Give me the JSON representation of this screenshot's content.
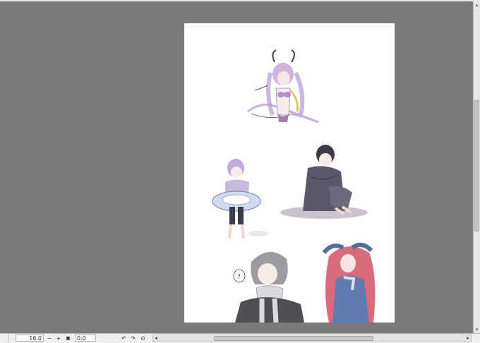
{
  "toolbar": {
    "zoom_value": "16.0",
    "zoom_out_glyph": "−",
    "zoom_in_glyph": "+",
    "fit_glyph": "■",
    "rotate_value": "0.0",
    "rotate_left_glyph": "↶",
    "rotate_right_glyph": "↷",
    "reset_rotation_glyph": "⊙",
    "scroll_left_glyph": "◂",
    "scroll_right_glyph": "▸"
  },
  "scrollbar": {
    "up_glyph": "▴",
    "down_glyph": "▾"
  },
  "canvas": {
    "speech_bubble_text": "?"
  },
  "colors": {
    "workspace": "#7a7a7a",
    "paper": "#ffffff",
    "toolbar": "#efefef"
  },
  "icons": [
    "rotate-left-icon",
    "rotate-right-icon",
    "reset-rotation-icon",
    "fit-icon"
  ]
}
